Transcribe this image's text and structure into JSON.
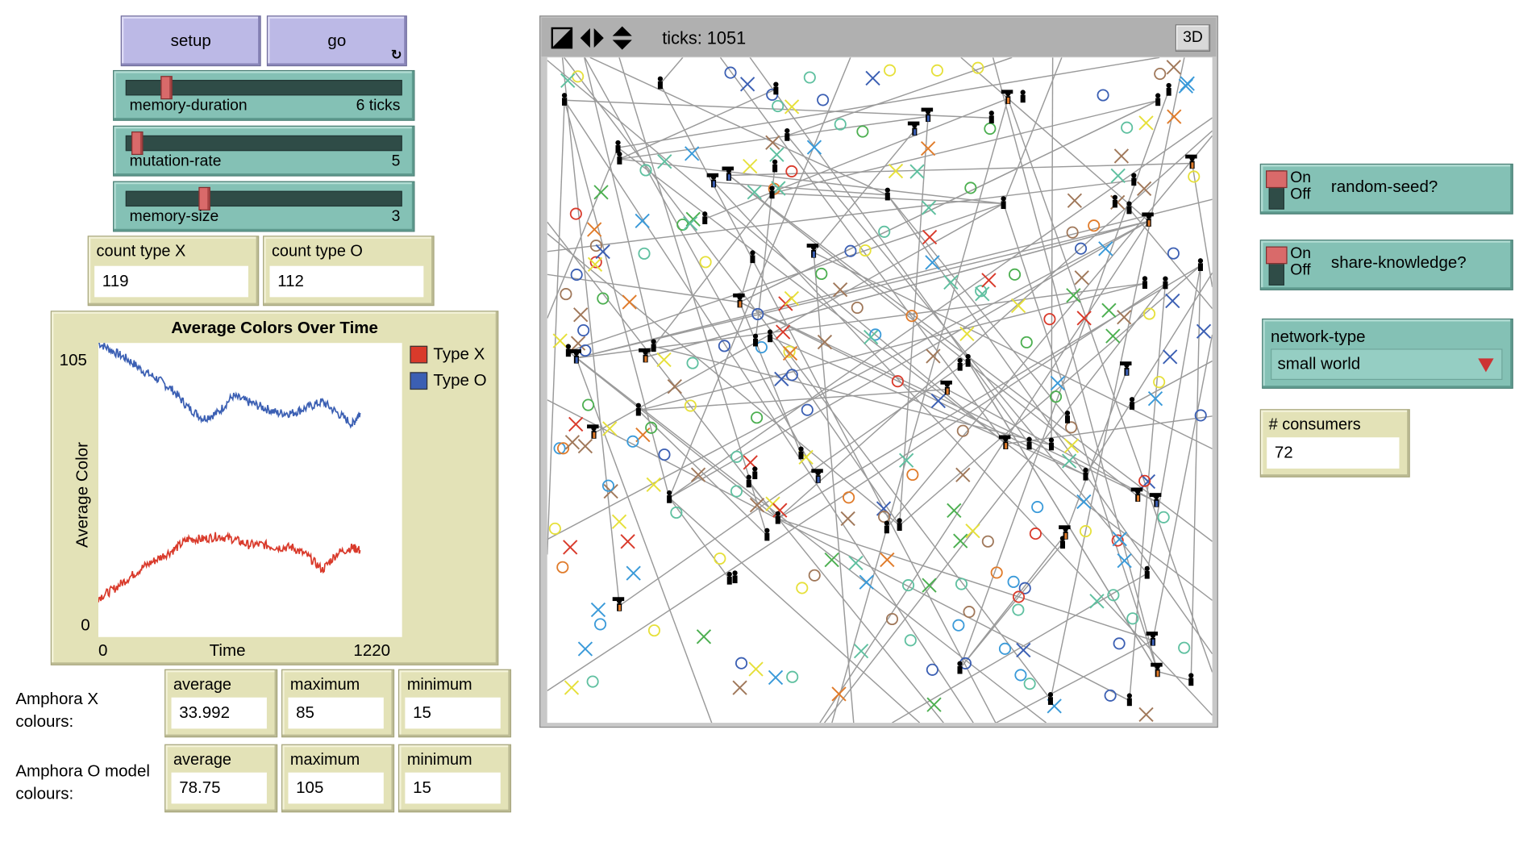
{
  "buttons": {
    "setup": "setup",
    "go": "go",
    "forever_icon": "↻"
  },
  "sliders": [
    {
      "id": "memory-duration",
      "label": "memory-duration",
      "value": "6 ticks",
      "fraction": 0.13
    },
    {
      "id": "mutation-rate",
      "label": "mutation-rate",
      "value": "5",
      "fraction": 0.02
    },
    {
      "id": "memory-size",
      "label": "memory-size",
      "value": "3",
      "fraction": 0.27
    }
  ],
  "monitors": {
    "count_x": {
      "label": "count type X",
      "value": "119"
    },
    "count_o": {
      "label": "count type O",
      "value": "112"
    },
    "consumers": {
      "label": "# consumers",
      "value": "72"
    }
  },
  "plot": {
    "title": "Average Colors Over Time",
    "ylabel": "Average Color",
    "xlabel": "Time",
    "xmin_label": "0",
    "xmax_label": "1220",
    "ymin_label": "0",
    "ymax_label": "105",
    "legend": [
      {
        "name": "Type X",
        "color": "#d93a2b"
      },
      {
        "name": "Type O",
        "color": "#3b5fb3"
      }
    ]
  },
  "chart_data": {
    "type": "line",
    "title": "Average Colors Over Time",
    "xlabel": "Time",
    "ylabel": "Average Color",
    "xlim": [
      0,
      1220
    ],
    "ylim": [
      0,
      105
    ],
    "series": [
      {
        "name": "Type O",
        "color": "#3b5fb3",
        "x": [
          0,
          60,
          120,
          180,
          240,
          300,
          360,
          420,
          480,
          540,
          600,
          660,
          720,
          780,
          840,
          900,
          960,
          1020,
          1051
        ],
        "values": [
          105,
          102,
          99,
          95,
          92,
          88,
          82,
          78,
          80,
          86,
          84,
          82,
          80,
          80,
          82,
          84,
          80,
          76,
          80
        ]
      },
      {
        "name": "Type X",
        "color": "#d93a2b",
        "x": [
          0,
          60,
          120,
          180,
          240,
          300,
          360,
          420,
          480,
          540,
          600,
          660,
          720,
          780,
          840,
          900,
          960,
          1020,
          1051
        ],
        "values": [
          14,
          17,
          21,
          25,
          28,
          31,
          35,
          35,
          36,
          35,
          33,
          33,
          32,
          32,
          29,
          24,
          30,
          32,
          31
        ]
      }
    ]
  },
  "amphora_x": {
    "label": "Amphora X colours:",
    "average": {
      "label": "average",
      "value": "33.992"
    },
    "maximum": {
      "label": "maximum",
      "value": "85"
    },
    "minimum": {
      "label": "minimum",
      "value": "15"
    }
  },
  "amphora_o": {
    "label": "Amphora O model colours:",
    "average": {
      "label": "average",
      "value": "78.75"
    },
    "maximum": {
      "label": "maximum",
      "value": "105"
    },
    "minimum": {
      "label": "minimum",
      "value": "15"
    }
  },
  "view": {
    "ticks": "ticks: 1051",
    "three_d": "3D"
  },
  "switches": [
    {
      "id": "random-seed",
      "on": "On",
      "off": "Off",
      "label": "random-seed?"
    },
    {
      "id": "share-knowledge",
      "on": "On",
      "off": "Off",
      "label": "share-knowledge?"
    }
  ],
  "chooser": {
    "label": "network-type",
    "value": "small world"
  }
}
